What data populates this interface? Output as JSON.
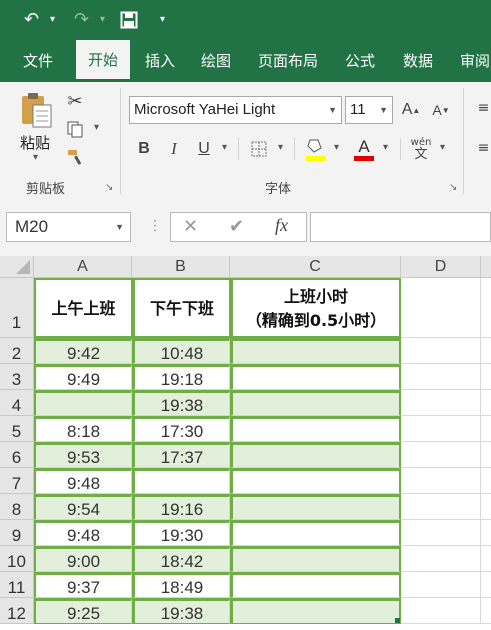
{
  "quick_access": {
    "undo_icon": "undo-icon",
    "redo_icon": "redo-icon",
    "save_icon": "save-icon",
    "customize_icon": "customize-icon"
  },
  "tabs": [
    {
      "label": "文件"
    },
    {
      "label": "开始"
    },
    {
      "label": "插入"
    },
    {
      "label": "绘图"
    },
    {
      "label": "页面布局"
    },
    {
      "label": "公式"
    },
    {
      "label": "数据"
    },
    {
      "label": "审阅"
    }
  ],
  "active_tab": "开始",
  "ribbon": {
    "clipboard": {
      "paste_label": "粘贴",
      "group_label": "剪贴板"
    },
    "font": {
      "font_name": "Microsoft YaHei Light",
      "font_size": "11",
      "group_label": "字体",
      "bold": "B",
      "italic": "I",
      "underline": "U",
      "phonetic": "wén",
      "phonetic_char": "文"
    }
  },
  "formula_bar": {
    "name_box": "M20",
    "cancel": "✕",
    "enter": "✔",
    "fx": "fx",
    "value": ""
  },
  "colors": {
    "excel_green": "#217346",
    "band": "#e2efda",
    "table_border": "#70ad47"
  },
  "sheet": {
    "columns": [
      "A",
      "B",
      "C",
      "D"
    ],
    "header_row": {
      "row": "1",
      "a": "上午上班",
      "b": "下午下班",
      "c1": "上班小时",
      "c2": "（精确到0.5小时）"
    },
    "rows": [
      {
        "row": "2",
        "a": "9:42",
        "b": "10:48",
        "c": ""
      },
      {
        "row": "3",
        "a": "9:49",
        "b": "19:18",
        "c": ""
      },
      {
        "row": "4",
        "a": "",
        "b": "19:38",
        "c": ""
      },
      {
        "row": "5",
        "a": "8:18",
        "b": "17:30",
        "c": ""
      },
      {
        "row": "6",
        "a": "9:53",
        "b": "17:37",
        "c": ""
      },
      {
        "row": "7",
        "a": "9:48",
        "b": "",
        "c": ""
      },
      {
        "row": "8",
        "a": "9:54",
        "b": "19:16",
        "c": ""
      },
      {
        "row": "9",
        "a": "9:48",
        "b": "19:30",
        "c": ""
      },
      {
        "row": "10",
        "a": "9:00",
        "b": "18:42",
        "c": ""
      },
      {
        "row": "11",
        "a": "9:37",
        "b": "18:49",
        "c": ""
      },
      {
        "row": "12",
        "a": "9:25",
        "b": "19:38",
        "c": ""
      }
    ]
  }
}
